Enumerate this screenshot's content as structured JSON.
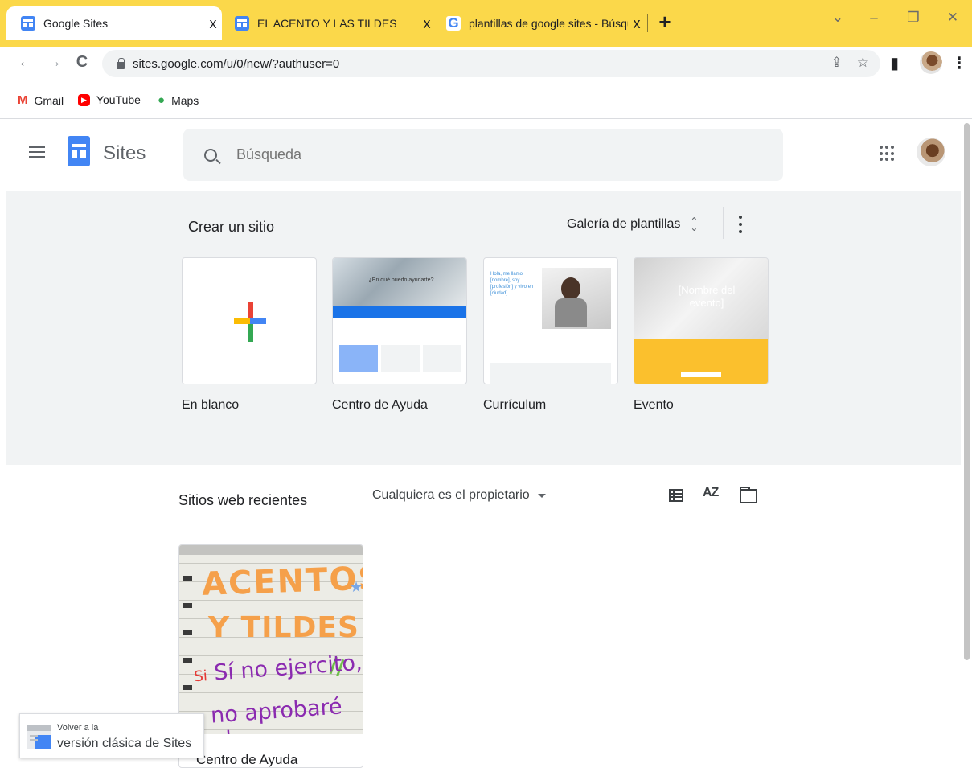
{
  "browser": {
    "tabs": [
      {
        "title": "Google Sites",
        "icon": "sites-icon",
        "active": true
      },
      {
        "title": "EL ACENTO Y LAS TILDES",
        "icon": "sites-icon",
        "active": false
      },
      {
        "title": "plantillas de google sites - Búsqu",
        "icon": "google-icon",
        "active": false
      }
    ],
    "tab_close": "x",
    "new_tab": "+",
    "window_controls": [
      "⌄",
      "–",
      "❐",
      "✕"
    ],
    "url": "sites.google.com/u/0/new/?authuser=0",
    "bookmarks": [
      {
        "label": "Gmail",
        "glyph": "M"
      },
      {
        "label": "YouTube",
        "glyph": "▶"
      },
      {
        "label": "Maps",
        "glyph": "●"
      }
    ],
    "accent": "#fbd84a"
  },
  "app": {
    "name": "Sites",
    "search_placeholder": "Búsqueda"
  },
  "create": {
    "title": "Crear un sitio",
    "gallery_label": "Galería de plantillas",
    "templates": [
      {
        "label": "En blanco"
      },
      {
        "label": "Centro de Ayuda",
        "thumb_text": "¿En qué puedo ayudarte?"
      },
      {
        "label": "Currículum",
        "thumb_text": "Hola, me llamo [nombre], soy [profesión] y vivo en [ciudad]."
      },
      {
        "label": "Evento",
        "thumb_text": "[Nombre del evento]"
      }
    ]
  },
  "recent": {
    "title": "Sitios web recientes",
    "owner_filter": "Cualquiera es el propietario",
    "sites": [
      {
        "name": "Centro de Ayuda",
        "thumb_lines": [
          "ACENTOS",
          "Y TILDES",
          "Si",
          "Sí no ejercito,",
          "no aprobaré el"
        ]
      }
    ]
  },
  "classic_banner": {
    "line1": "Volver a la",
    "line2": "versión clásica de Sites"
  },
  "colors": {
    "sites_blue": "#4285f4",
    "panel_gray": "#f1f3f4"
  }
}
